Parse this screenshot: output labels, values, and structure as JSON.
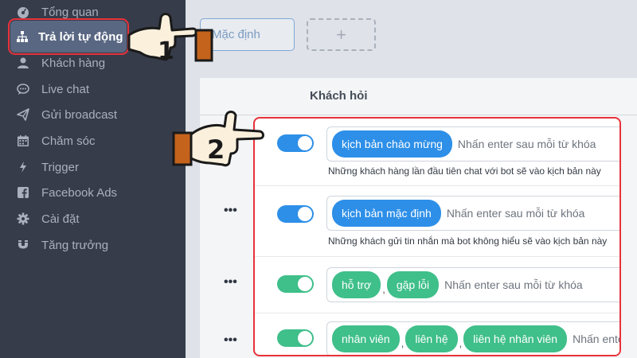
{
  "sidebar": {
    "items": [
      {
        "label": "Tổng quan",
        "icon": "dashboard-icon"
      },
      {
        "label": "Trả lời tự động",
        "icon": "sitemap-icon",
        "active": true
      },
      {
        "label": "Khách hàng",
        "icon": "user-icon"
      },
      {
        "label": "Live chat",
        "icon": "chat-icon"
      },
      {
        "label": "Gửi broadcast",
        "icon": "send-icon"
      },
      {
        "label": "Chăm sóc",
        "icon": "calendar-icon"
      },
      {
        "label": "Trigger",
        "icon": "bolt-icon"
      },
      {
        "label": "Facebook Ads",
        "icon": "facebook-icon"
      },
      {
        "label": "Cài đặt",
        "icon": "gear-icon"
      },
      {
        "label": "Tăng trưởng",
        "icon": "magnet-icon"
      }
    ]
  },
  "toolbar": {
    "default_label": "Mặc định",
    "add_label": "+"
  },
  "table": {
    "column_header": "Khách hỏi",
    "row_menu": "•••",
    "rows": [
      {
        "enabled": true,
        "toggle_color": "#2d8fe8",
        "chips": [
          {
            "label": "kịch bản chào mừng",
            "color": "blue"
          }
        ],
        "placeholder": "Nhấn enter sau mỗi từ khóa",
        "description": "Những khách hàng lần đầu tiên chat với bot sẽ vào kịch bản này"
      },
      {
        "enabled": true,
        "toggle_color": "#2d8fe8",
        "chips": [
          {
            "label": "kịch bản mặc định",
            "color": "blue"
          }
        ],
        "placeholder": "Nhấn enter sau mỗi từ khóa",
        "description": "Những khách gửi tin nhắn mà bot không hiểu sẽ vào kịch bản này"
      },
      {
        "enabled": true,
        "toggle_color": "#3fbf8a",
        "chips": [
          {
            "label": "hỗ trợ",
            "color": "green"
          },
          {
            "label": "gặp lỗi",
            "color": "green"
          }
        ],
        "placeholder": "Nhấn enter sau mỗi từ khóa",
        "description": ""
      },
      {
        "enabled": true,
        "toggle_color": "#3fbf8a",
        "chips": [
          {
            "label": "nhân viên",
            "color": "green"
          },
          {
            "label": "liên hệ",
            "color": "green"
          },
          {
            "label": "liên hệ nhân viên",
            "color": "green"
          }
        ],
        "placeholder": "Nhấn enter sau mỗi từ khóa",
        "description": ""
      }
    ]
  },
  "annotations": {
    "step1": "1",
    "step2": "2"
  },
  "colors": {
    "highlight": "#e8323a",
    "sidebar_bg": "#363c4a",
    "active_item_bg": "#596782",
    "chip_blue": "#2d8fe8",
    "chip_green": "#3fbf8a"
  }
}
